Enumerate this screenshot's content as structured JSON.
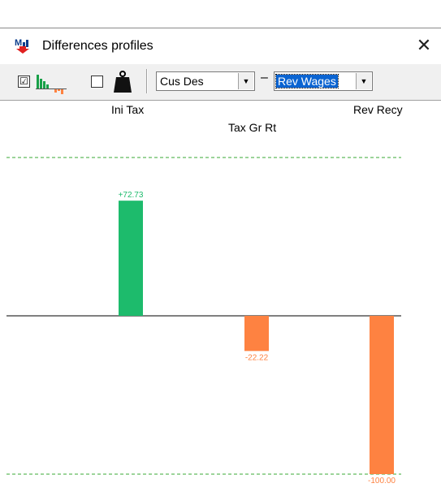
{
  "window": {
    "title": "Differences profiles",
    "close_glyph": "✕",
    "app_icon": "m-chart-icon"
  },
  "toolbar": {
    "bars_checkbox": {
      "checked": true,
      "glyph": "☑"
    },
    "bars_icon": "bar-chart-icon",
    "weight_checkbox": {
      "checked": false
    },
    "weight_icon": "weight-icon",
    "dropdown_left": {
      "value": "Cus Des"
    },
    "dash": "–",
    "dropdown_right": {
      "value": "Rev Wages"
    }
  },
  "colors": {
    "positive": "#1dbb6c",
    "negative": "#fe8241",
    "reference": "#3aaa35",
    "axis": "#000000"
  },
  "chart_data": {
    "type": "bar",
    "categories": [
      "Ini Tax",
      "Tax Gr Rt",
      "Rev Recy"
    ],
    "values": [
      72.73,
      -22.22,
      -100.0
    ],
    "value_labels": [
      "+72.73",
      "-22.22",
      "-100.00"
    ],
    "reference_lines": [
      100,
      -100
    ],
    "ylim": [
      -100,
      100
    ],
    "grid": false,
    "title": "",
    "xlabel": "",
    "ylabel": ""
  }
}
